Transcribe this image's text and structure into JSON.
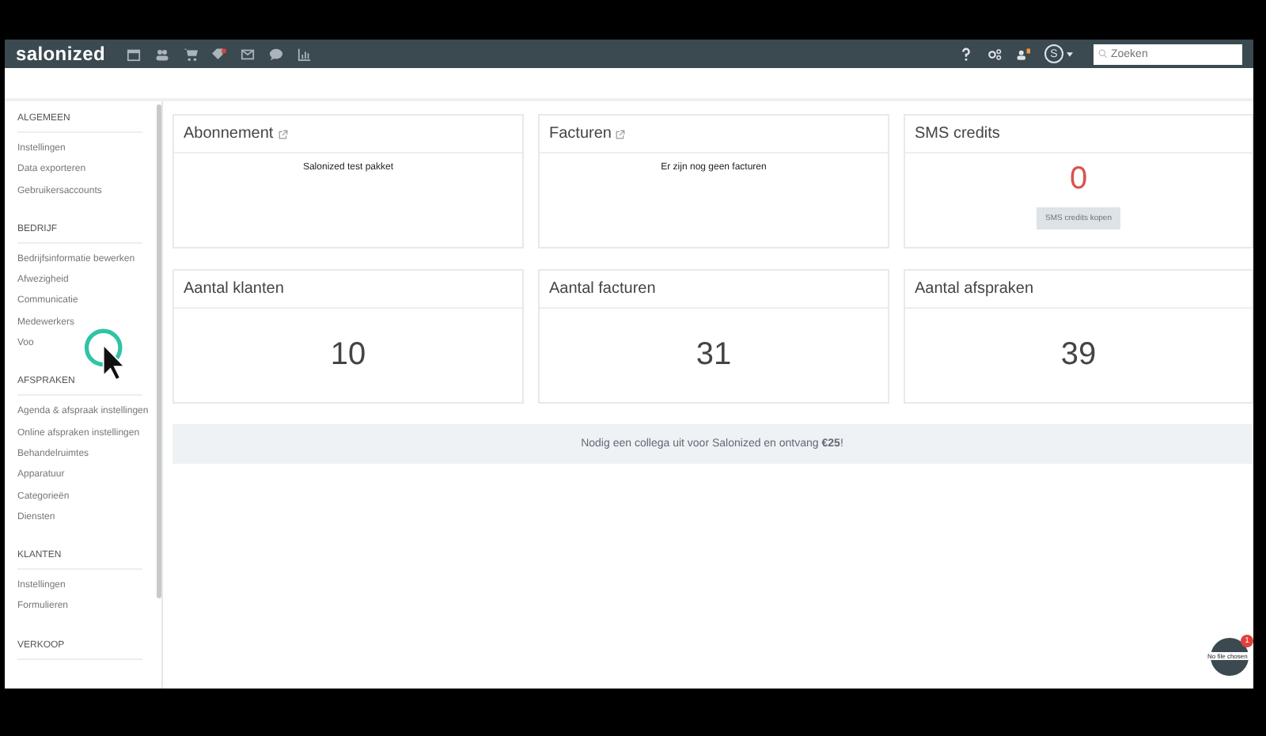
{
  "navbar": {
    "logo": "salonized",
    "search": {
      "placeholder": "Zoeken"
    },
    "user_initial": "S"
  },
  "sidebar": {
    "sections": [
      {
        "title": "ALGEMEEN",
        "items": [
          "Instellingen",
          "Data exporteren",
          "Gebruikersaccounts"
        ]
      },
      {
        "title": "BEDRIJF",
        "items": [
          "Bedrijfsinformatie bewerken",
          "Afwezigheid",
          "Communicatie",
          "Medewerkers",
          "Voo"
        ]
      },
      {
        "title": "AFSPRAKEN",
        "items": [
          "Agenda & afspraak instellingen",
          "Online afspraken instellingen",
          "Behandelruimtes",
          "Apparatuur",
          "Categorieën",
          "Diensten"
        ]
      },
      {
        "title": "KLANTEN",
        "items": [
          "Instellingen",
          "Formulieren"
        ]
      },
      {
        "title": "VERKOOP"
      }
    ]
  },
  "cards": [
    {
      "kind": "text",
      "title": "Abonnement",
      "external": true,
      "body": "Salonized test pakket"
    },
    {
      "kind": "text",
      "title": "Facturen",
      "external": true,
      "body": "Er zijn nog geen facturen"
    },
    {
      "kind": "credits",
      "title": "SMS credits",
      "external": false,
      "value": "0",
      "button": "SMS credits kopen"
    },
    {
      "kind": "count",
      "title": "Aantal klanten",
      "external": false,
      "value": "10"
    },
    {
      "kind": "count",
      "title": "Aantal facturen",
      "external": false,
      "value": "31"
    },
    {
      "kind": "count",
      "title": "Aantal afspraken",
      "external": false,
      "value": "39"
    }
  ],
  "invite_banner": "Nodig een collega uit voor Salonized en ontvang **€25**!",
  "help_widget": {
    "badge": "1",
    "file_label": "No file chosen"
  }
}
